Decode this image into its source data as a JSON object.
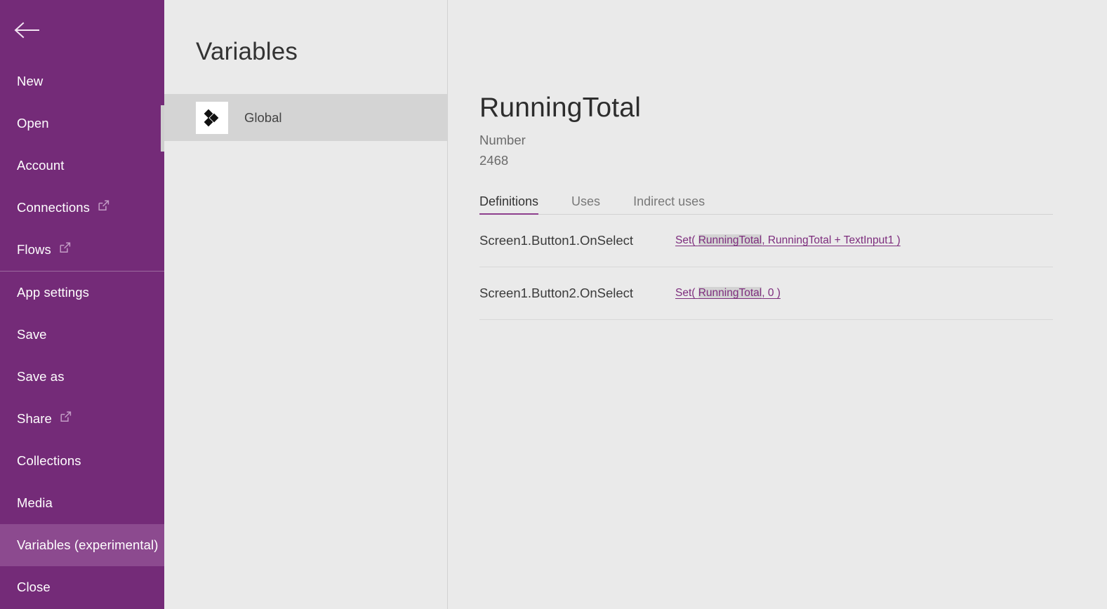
{
  "sidebar": {
    "back_icon": "back-arrow-icon",
    "items": [
      {
        "label": "New",
        "external": false,
        "selected": false,
        "divider_after": false
      },
      {
        "label": "Open",
        "external": false,
        "selected": false,
        "divider_after": false
      },
      {
        "label": "Account",
        "external": false,
        "selected": false,
        "divider_after": false
      },
      {
        "label": "Connections",
        "external": true,
        "selected": false,
        "divider_after": false
      },
      {
        "label": "Flows",
        "external": true,
        "selected": false,
        "divider_after": true
      },
      {
        "label": "App settings",
        "external": false,
        "selected": false,
        "divider_after": false
      },
      {
        "label": "Save",
        "external": false,
        "selected": false,
        "divider_after": false
      },
      {
        "label": "Save as",
        "external": false,
        "selected": false,
        "divider_after": false
      },
      {
        "label": "Share",
        "external": true,
        "selected": false,
        "divider_after": false
      },
      {
        "label": "Collections",
        "external": false,
        "selected": false,
        "divider_after": false
      },
      {
        "label": "Media",
        "external": false,
        "selected": false,
        "divider_after": false
      },
      {
        "label": "Variables (experimental)",
        "external": false,
        "selected": true,
        "divider_after": false
      },
      {
        "label": "Close",
        "external": false,
        "selected": false,
        "divider_after": false
      }
    ],
    "colors": {
      "background": "#742b78",
      "selected": "#8c4a8f",
      "divider": "#9c6a9e",
      "text": "#ffffff"
    }
  },
  "list_panel": {
    "title": "Variables",
    "variables": [
      {
        "name": "Global",
        "icon": "global-variables-icon",
        "selected": true
      }
    ]
  },
  "detail": {
    "title": "RunningTotal",
    "type": "Number",
    "value": "2468",
    "tabs": [
      {
        "label": "Definitions",
        "active": true
      },
      {
        "label": "Uses",
        "active": false
      },
      {
        "label": "Indirect uses",
        "active": false
      }
    ],
    "definitions": [
      {
        "source": "Screen1.Button1.OnSelect",
        "formula_prefix": "Set( ",
        "formula_highlight": "RunningTotal",
        "formula_suffix": ", RunningTotal + TextInput1 )"
      },
      {
        "source": "Screen1.Button2.OnSelect",
        "formula_prefix": "Set( ",
        "formula_highlight": "RunningTotal",
        "formula_suffix": ", 0 )"
      }
    ],
    "colors": {
      "accent": "#8d3f8d",
      "formula_link": "#7d2d7d",
      "highlight": "#d3d3d3",
      "background": "#eaeaea"
    }
  }
}
